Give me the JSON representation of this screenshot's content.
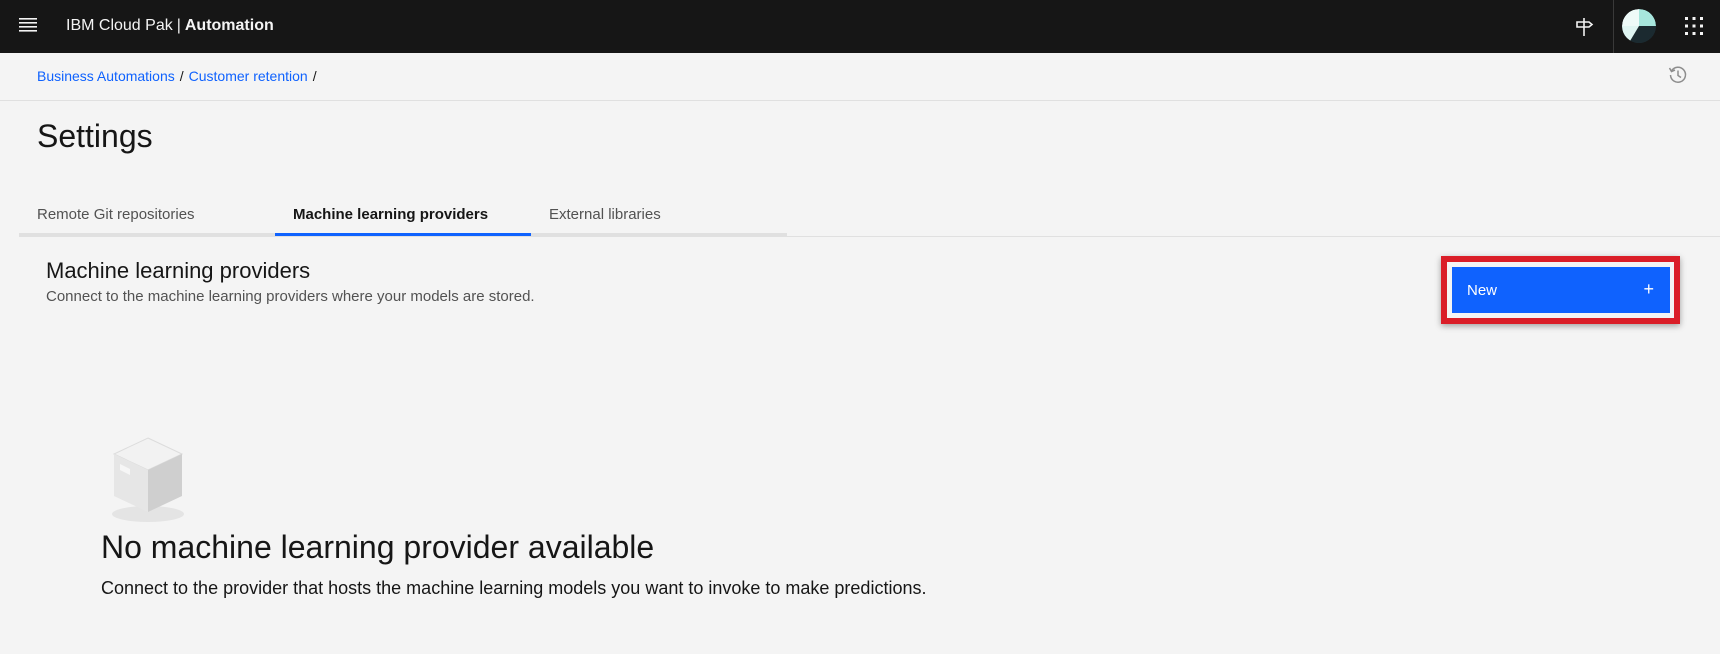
{
  "header": {
    "brand_prefix": "IBM Cloud Pak",
    "brand_separator": "|",
    "brand_product": "Automation",
    "icons": [
      "menu-icon",
      "signpost-icon",
      "avatar",
      "app-switcher-icon"
    ]
  },
  "breadcrumb": {
    "items": [
      "Business Automations",
      "Customer retention"
    ],
    "separator": "/"
  },
  "page": {
    "title": "Settings"
  },
  "tabs": [
    {
      "label": "Remote Git repositories",
      "active": false
    },
    {
      "label": "Machine learning providers",
      "active": true
    },
    {
      "label": "External libraries",
      "active": false
    }
  ],
  "section": {
    "title": "Machine learning providers",
    "description": "Connect to the machine learning providers where your models are stored.",
    "new_button_label": "New",
    "new_button_icon": "+"
  },
  "empty_state": {
    "title": "No machine learning provider available",
    "description": "Connect to the provider that hosts the machine learning models you want to invoke to make predictions."
  },
  "colors": {
    "header_bg": "#161616",
    "accent": "#0f62fe",
    "highlight": "#da1e28",
    "background": "#f4f4f4"
  }
}
